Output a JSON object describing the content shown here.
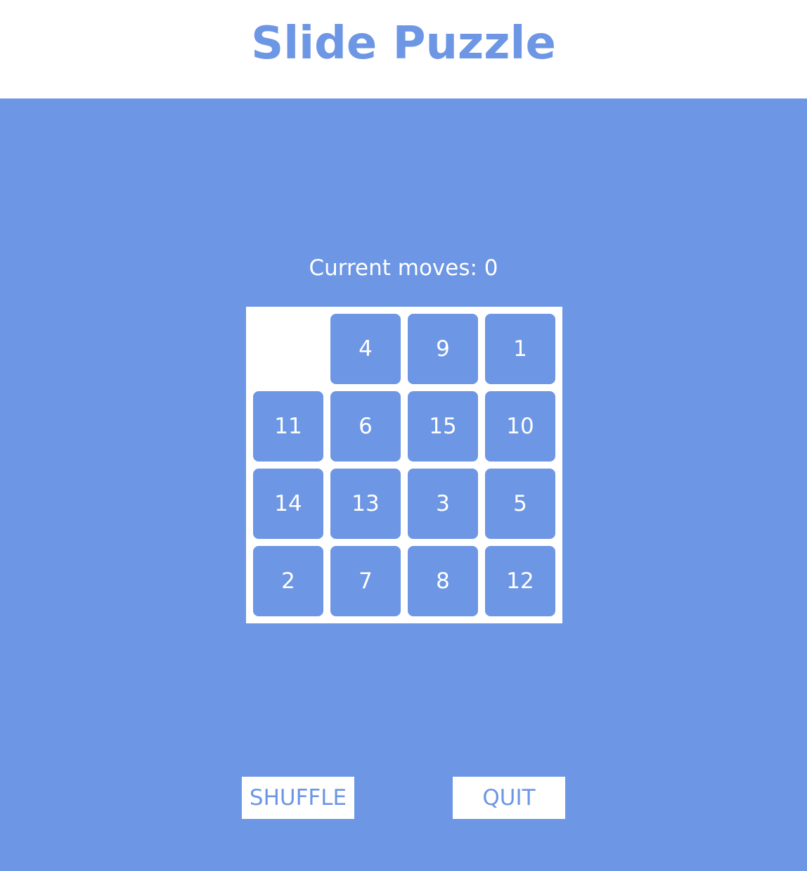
{
  "header": {
    "title": "Slide Puzzle"
  },
  "status": {
    "moves_text": "Current moves: 0"
  },
  "board": {
    "tiles": [
      "",
      "4",
      "9",
      "1",
      "11",
      "6",
      "15",
      "10",
      "14",
      "13",
      "3",
      "5",
      "2",
      "7",
      "8",
      "12"
    ]
  },
  "buttons": {
    "shuffle_label": "SHUFFLE",
    "quit_label": "QUIT"
  },
  "colors": {
    "accent": "#6d96e4",
    "background": "#ffffff"
  }
}
